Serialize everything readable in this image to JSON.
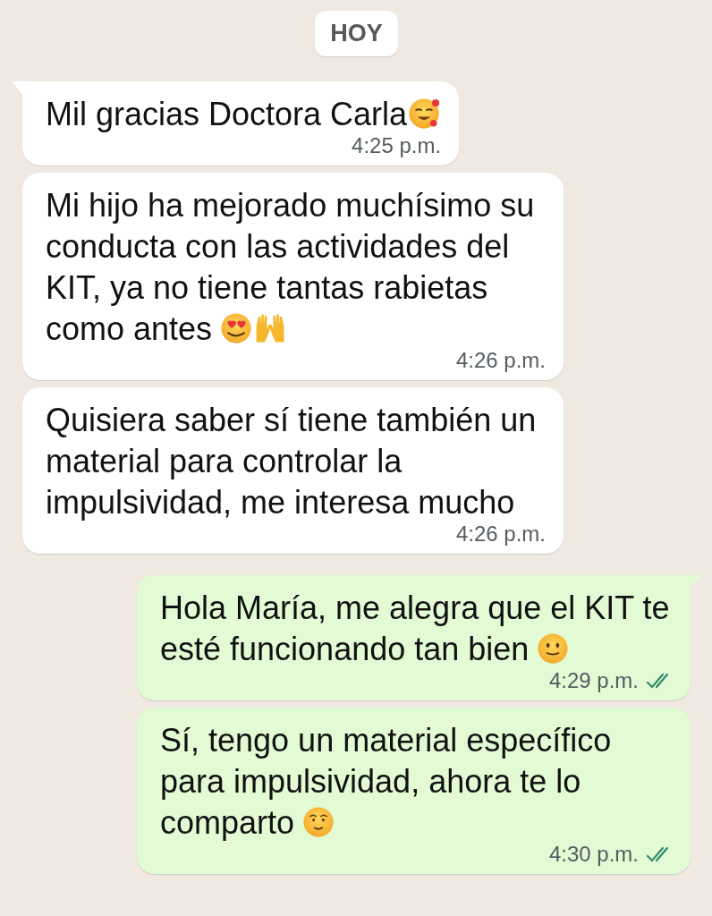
{
  "date_chip": "HOY",
  "messages": [
    {
      "kind": "incoming",
      "tail": true,
      "text": "Mil gracias Doctora Carla",
      "emoji": [
        {
          "kind": "smiling_hearts"
        }
      ],
      "time": "4:25 p.m."
    },
    {
      "kind": "incoming",
      "tail": false,
      "text": "Mi hijo ha mejorado muchísimo su conducta con las actividades del KIT, ya no tiene tantas rabietas como antes",
      "emoji": [
        {
          "kind": "heart_eyes"
        },
        {
          "kind": "raised_hands"
        }
      ],
      "time": "4:26 p.m."
    },
    {
      "kind": "incoming",
      "tail": false,
      "text": "Quisiera saber sí tiene también un material para controlar la impulsividad, me interesa mucho",
      "time": "4:26 p.m."
    },
    {
      "kind": "outgoing",
      "tail": true,
      "text": "Hola María, me alegra que el KIT te esté funcionando tan bien",
      "emoji": [
        {
          "kind": "slight_smile"
        }
      ],
      "time": "4:29 p.m.",
      "read": true
    },
    {
      "kind": "outgoing",
      "tail": false,
      "text": "Sí, tengo un material específico para impulsividad, ahora te lo comparto",
      "emoji": [
        {
          "kind": "blushing_smile"
        }
      ],
      "time": "4:30 p.m.",
      "read": true
    }
  ]
}
